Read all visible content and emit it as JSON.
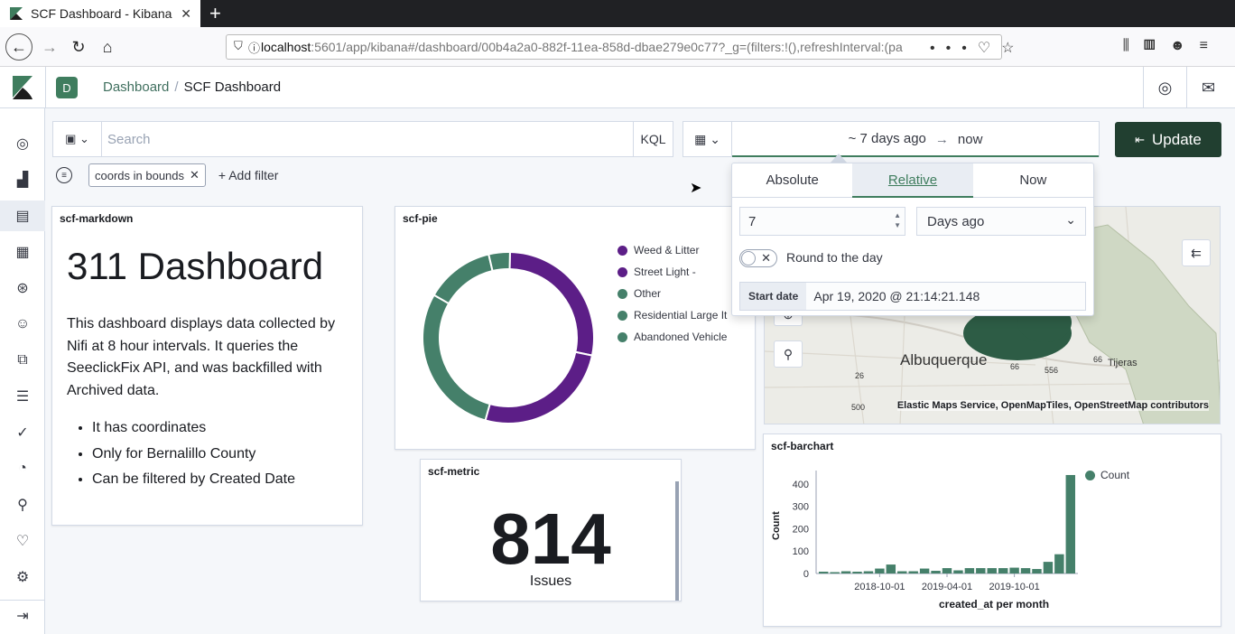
{
  "browser": {
    "tab_title": "SCF Dashboard - Kibana",
    "url_host": "localhost",
    "url_rest": ":5601/app/kibana#/dashboard/00b4a2a0-882f-11ea-858d-dbae279e0c77?_g=(filters:!(),refreshInterval:(pa"
  },
  "header": {
    "space_initial": "D",
    "breadcrumb_parent": "Dashboard",
    "breadcrumb_sep": "/",
    "breadcrumb_current": "SCF Dashboard"
  },
  "query": {
    "placeholder": "Search",
    "language": "KQL"
  },
  "time": {
    "start": "~ 7 days ago",
    "end": "now",
    "update_label": "Update"
  },
  "filters": {
    "pill": "coords in bounds",
    "add_label": "+ Add filter"
  },
  "popover": {
    "tabs": [
      "Absolute",
      "Relative",
      "Now"
    ],
    "active_tab": "Relative",
    "amount": "7",
    "unit": "Days ago",
    "round_label": "Round to the day",
    "start_label": "Start date",
    "start_value": "Apr 19, 2020 @ 21:14:21.148"
  },
  "markdown": {
    "title": "scf-markdown",
    "heading": "311 Dashboard",
    "paragraph": "This dashboard displays data collected by Nifi at 8 hour intervals. It queries the SeeclickFix API, and was backfilled with Archived data.",
    "bullets": [
      "It has coordinates",
      "Only for Bernalillo County",
      "Can be filtered by Created Date"
    ]
  },
  "pie": {
    "title": "scf-pie",
    "legend": [
      {
        "label": "Weed & Litter",
        "color": "#5c1e87"
      },
      {
        "label": "Street Light -",
        "color": "#5c1e87"
      },
      {
        "label": "Other",
        "color": "#45806a"
      },
      {
        "label": "Residential Large It",
        "color": "#45806a"
      },
      {
        "label": "Abandoned Vehicle",
        "color": "#45806a"
      }
    ]
  },
  "metric": {
    "title": "scf-metric",
    "value": "814",
    "label": "Issues"
  },
  "map": {
    "labels": [
      "Albuquerque",
      "Tijeras",
      "66",
      "556",
      "66",
      "500",
      "26"
    ],
    "attribution": "Elastic Maps Service, OpenMapTiles, OpenStreetMap contributors"
  },
  "barchart": {
    "title": "scf-barchart",
    "legend": "Count",
    "ylabel": "Count",
    "xlabel": "created_at per month",
    "xticks": [
      "2018-10-01",
      "2019-04-01",
      "2019-10-01"
    ]
  },
  "chart_data": [
    {
      "type": "pie",
      "title": "scf-pie",
      "donut": true,
      "slices": [
        {
          "label": "Weed & Litter",
          "value": 28,
          "color": "#5c1e87"
        },
        {
          "label": "Street Light -",
          "value": 26,
          "color": "#5c1e87"
        },
        {
          "label": "Other",
          "value": 29,
          "color": "#45806a"
        },
        {
          "label": "Residential Large It",
          "value": 13,
          "color": "#45806a"
        },
        {
          "label": "Abandoned Vehicle",
          "value": 4,
          "color": "#45806a"
        }
      ]
    },
    {
      "type": "bar",
      "title": "scf-barchart",
      "xlabel": "created_at per month",
      "ylabel": "Count",
      "ylim": [
        0,
        460
      ],
      "yticks": [
        0,
        100,
        200,
        300,
        400
      ],
      "xticks": [
        "2018-10-01",
        "2019-04-01",
        "2019-10-01"
      ],
      "series": [
        {
          "name": "Count",
          "color": "#45806a",
          "values": [
            8,
            6,
            10,
            8,
            10,
            22,
            40,
            10,
            10,
            22,
            12,
            24,
            14,
            24,
            24,
            24,
            24,
            26,
            24,
            20,
            52,
            86,
            440
          ]
        }
      ]
    }
  ]
}
